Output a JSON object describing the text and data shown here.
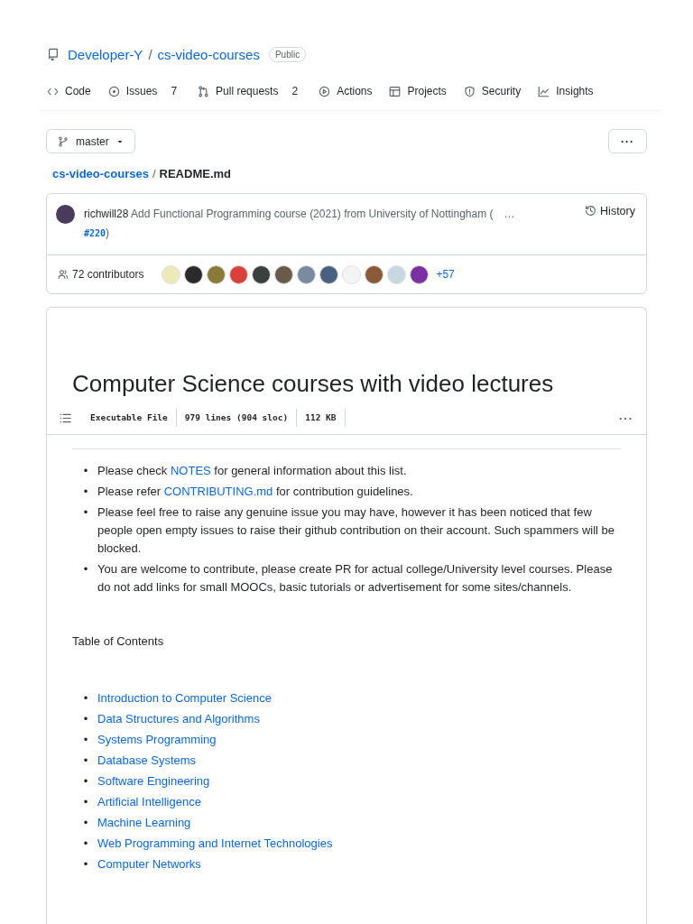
{
  "repo": {
    "owner": "Developer-Y",
    "separator": "/",
    "name": "cs-video-courses",
    "visibility": "Public"
  },
  "tabs": [
    {
      "kind": "code",
      "label": "Code",
      "selected": false
    },
    {
      "kind": "issues",
      "label": "Issues",
      "count": "7",
      "selected": false
    },
    {
      "kind": "pulls",
      "label": "Pull requests",
      "count": "2",
      "selected": false
    },
    {
      "kind": "actions",
      "label": "Actions",
      "selected": false
    },
    {
      "kind": "projects",
      "label": "Projects",
      "selected": false
    },
    {
      "kind": "security",
      "label": "Security",
      "selected": false
    },
    {
      "kind": "insights",
      "label": "Insights",
      "selected": false
    }
  ],
  "branch": "master",
  "more_button": "···",
  "breadcrumb": {
    "repo": "cs-video-courses",
    "separator": "/",
    "file": "README.md"
  },
  "commit": {
    "author": "richwill28",
    "message": "Add Functional Programming course (2021) from University of Nottingham (",
    "expand": "…",
    "pr": "#220",
    "close": ")",
    "history": "History"
  },
  "contributors": {
    "label": "72 contributors",
    "more": "+57"
  },
  "readme": {
    "title": "Computer Science courses with video lectures",
    "file_info": [
      "Executable File",
      "979 lines (904 sloc)",
      "112 KB"
    ],
    "menu": "···",
    "bullets": [
      {
        "marker": "•",
        "before": "Please check ",
        "link": "NOTES",
        "after": " for general information about this list."
      },
      {
        "marker": "•",
        "before": "Please refer ",
        "link": "CONTRIBUTING.md",
        "after": " for contribution guidelines."
      },
      {
        "marker": "•",
        "before": "Please feel free to raise any genuine issue you may have, however it has been noticed that few people open empty issues to raise their github contribution on their account. Such spammers will be blocked."
      },
      {
        "marker": "•",
        "before": "You are welcome to contribute, please create PR for actual college/University level courses. Please do not add links for small MOOCs, basic tutorials or advertisement for some sites/channels."
      }
    ],
    "toc_label": "Table of Contents",
    "toc": [
      {
        "marker": "•",
        "text": "Introduction to Computer Science"
      },
      {
        "marker": "•",
        "text": "Data Structures and Algorithms"
      },
      {
        "marker": "•",
        "text": "Systems Programming"
      },
      {
        "marker": "•",
        "text": "Database Systems"
      },
      {
        "marker": "•",
        "text": "Software Engineering"
      },
      {
        "marker": "•",
        "text": "Artificial Intelligence"
      },
      {
        "marker": "•",
        "text": "Machine Learning"
      },
      {
        "marker": "•",
        "text": "Web Programming and Internet Technologies"
      },
      {
        "marker": "•",
        "text": "Computer Networks"
      }
    ]
  }
}
